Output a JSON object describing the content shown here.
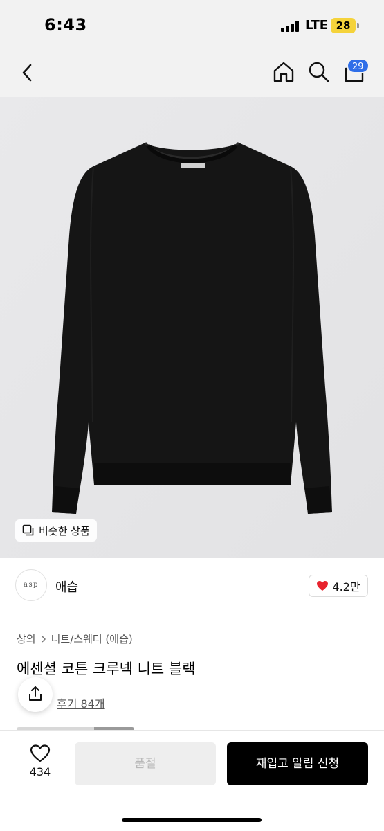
{
  "status_bar": {
    "time": "6:43",
    "network": "LTE",
    "battery": "28",
    "battery_color": "#f5d33b"
  },
  "nav": {
    "back_icon": "chevron-left-icon",
    "home_icon": "home-icon",
    "search_icon": "search-icon",
    "cart_icon": "shopping-bag-icon",
    "cart_badge": "29",
    "badge_color": "#2f6ee8"
  },
  "product": {
    "image_alt_icon": "black-sweater-photo",
    "similar_button_label": "비슷한 상품",
    "brand": {
      "logo_text": "asp",
      "name": "애습"
    },
    "likes": "4.2만",
    "breadcrumb": {
      "category": "상의",
      "subcategory": "니트/스웨터 (애습)"
    },
    "title": "에센셜 코튼 크루넥 니트 블랙",
    "review_link": "후기 84개"
  },
  "bottom_bar": {
    "wish_count": "434",
    "soldout_label": "품절",
    "restock_label": "재입고 알림 신청"
  },
  "colors": {
    "heart": "#e8232e",
    "primary_button": "#000000",
    "disabled_button": "#eeeeee"
  }
}
